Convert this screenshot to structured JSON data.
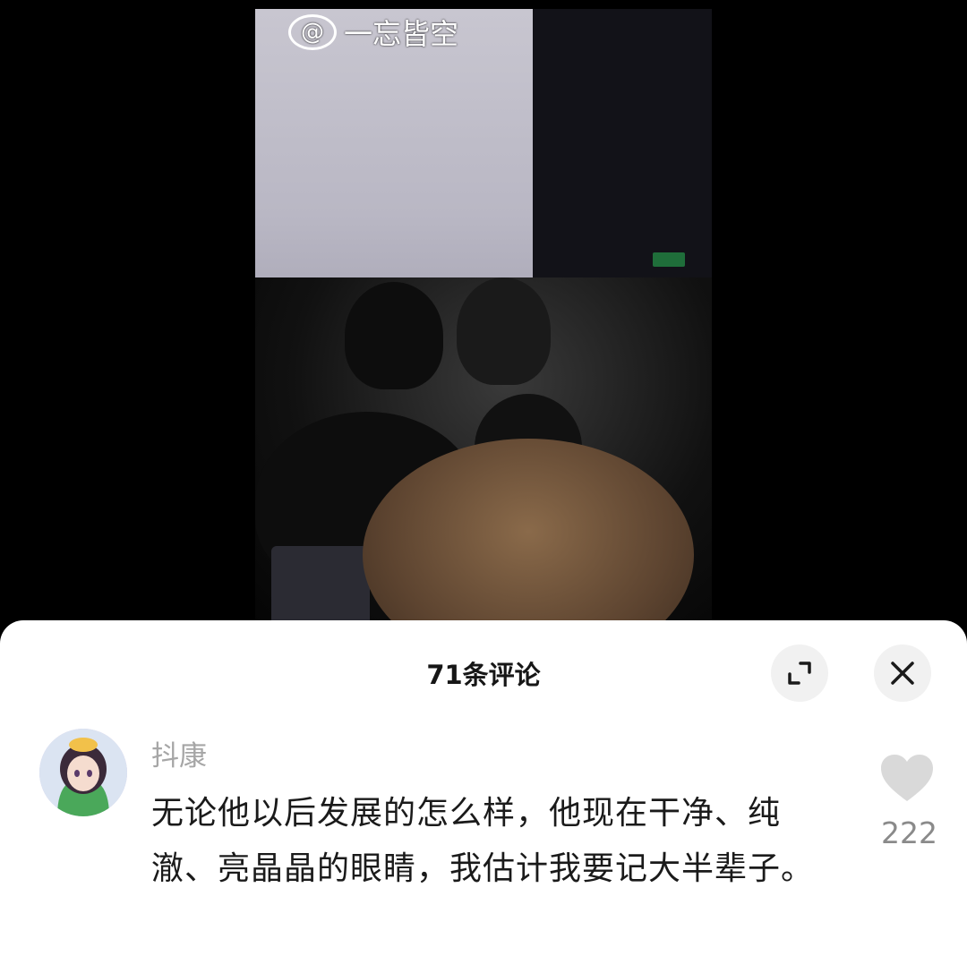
{
  "watermark": {
    "at_symbol": "@",
    "text": "一忘皆空"
  },
  "comments_sheet": {
    "title": "71条评论",
    "expand_icon": "expand-icon",
    "close_icon": "close-icon"
  },
  "comment": {
    "username": "抖康",
    "text": "无论他以后发展的怎么样，他现在干净、纯澈、亮晶晶的眼睛，我估计我要记大半辈子。",
    "likes": "222",
    "like_icon": "heart-icon"
  },
  "colors": {
    "sheet_bg": "#ffffff",
    "heart": "#d9d9d9",
    "username": "#a6a6a6"
  }
}
